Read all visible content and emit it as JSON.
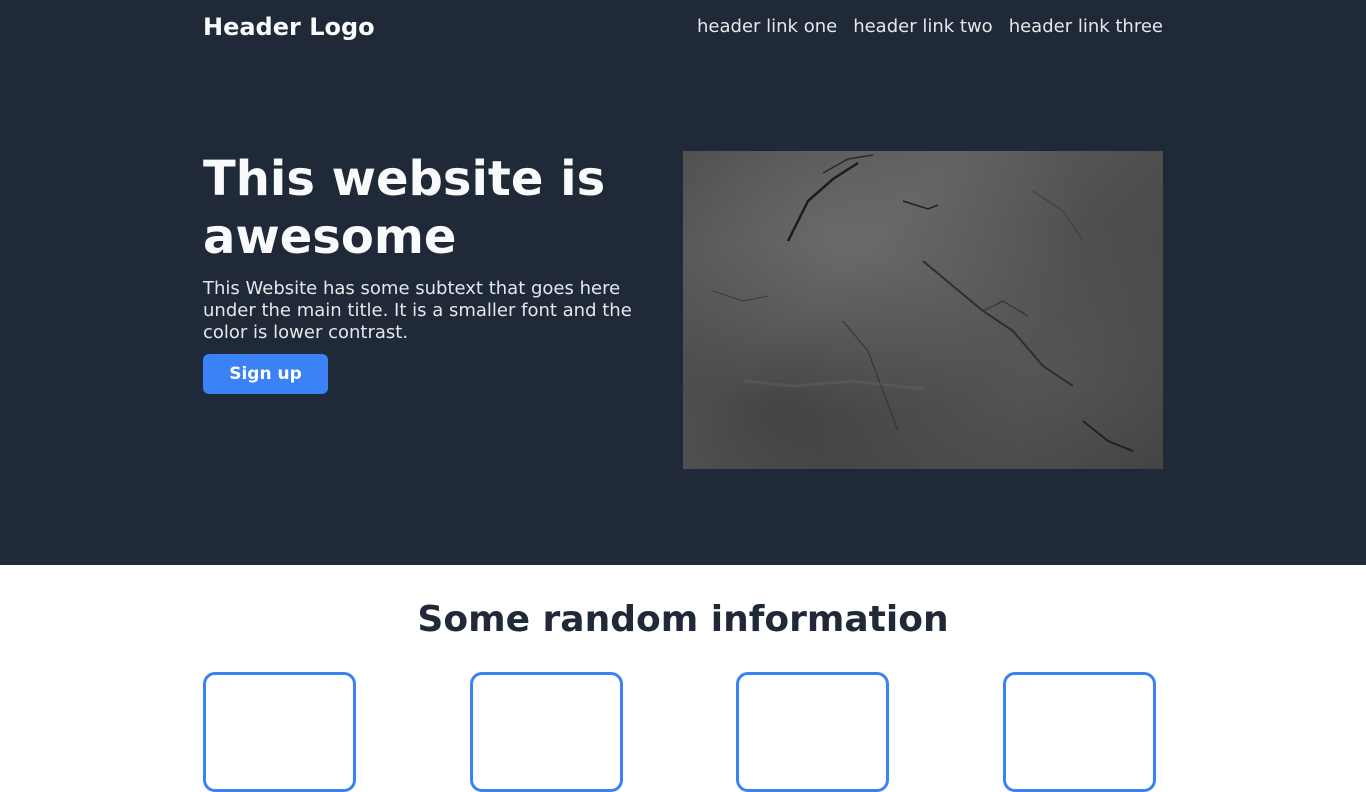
{
  "header": {
    "logo": "Header Logo",
    "links": [
      "header link one",
      "header link two",
      "header link three"
    ]
  },
  "hero": {
    "title": "This website is awesome",
    "subtext": "This Website has some subtext that goes here under the main title. It is a smaller font and the color is lower contrast.",
    "signup_label": "Sign up",
    "image": "stone-texture-image"
  },
  "info": {
    "title": "Some random information",
    "card_count": 4
  },
  "colors": {
    "hero_background": "#1f2937",
    "accent": "#3b82f6",
    "heading_light": "#f9fafb",
    "text_muted": "#e5e7eb",
    "heading_dark": "#1f2937"
  }
}
